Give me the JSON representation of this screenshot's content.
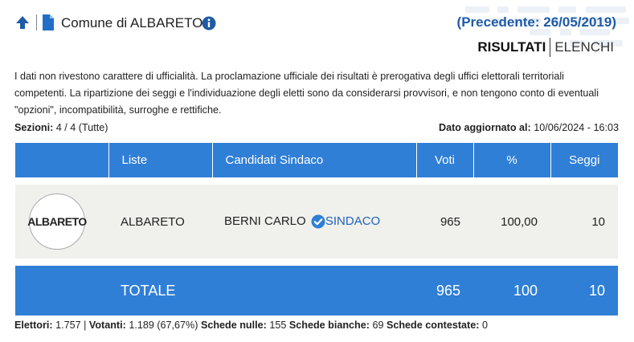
{
  "header": {
    "back_icon": "arrow-up-icon",
    "doc_icon": "document-icon",
    "title": "Comune di ALBARETO",
    "info_icon": "info-icon",
    "previous_link": "(Precedente: 26/05/2019)"
  },
  "tabs": {
    "risultati": "RISULTATI",
    "elenchi": "ELENCHI"
  },
  "disclaimer": "I dati non rivestono carattere di ufficialità. La proclamazione ufficiale dei risultati è prerogativa degli uffici elettorali territoriali competenti. La ripartizione dei seggi e l'individuazione degli eletti sono da considerarsi provvisori, e non tengono conto di eventuali \"opzioni\", incompatibilità, surroghe e rettifiche.",
  "sezioni": {
    "label": "Sezioni:",
    "value": "4 / 4 (Tutte)"
  },
  "updated": {
    "label": "Dato aggiornato al:",
    "value": "10/06/2024 - 16:03"
  },
  "table": {
    "headers": {
      "liste": "Liste",
      "candidati": "Candidati Sindaco",
      "voti": "Voti",
      "perc": "%",
      "seggi": "Seggi"
    },
    "row": {
      "logo_text": "ALBARETO",
      "lista": "ALBARETO",
      "candidato": "BERNI CARLO",
      "elected_icon": "check-badge-icon",
      "sindaco_label": "SINDACO",
      "voti": "965",
      "perc": "100,00",
      "seggi": "10"
    },
    "total": {
      "label": "TOTALE",
      "voti": "965",
      "perc": "100",
      "seggi": "10"
    }
  },
  "footer": {
    "elettori_label": "Elettori:",
    "elettori_value": "1.757",
    "votanti_label": "Votanti:",
    "votanti_value": "1.189 (67,67%)",
    "nulle_label": "Schede nulle:",
    "nulle_value": "155",
    "bianche_label": "Schede bianche:",
    "bianche_value": "69",
    "contestate_label": "Schede contestate:",
    "contestate_value": "0"
  },
  "colors": {
    "accent": "#2f7fd6",
    "link": "#1f5ba6",
    "row_bg": "#f0f0ed"
  }
}
